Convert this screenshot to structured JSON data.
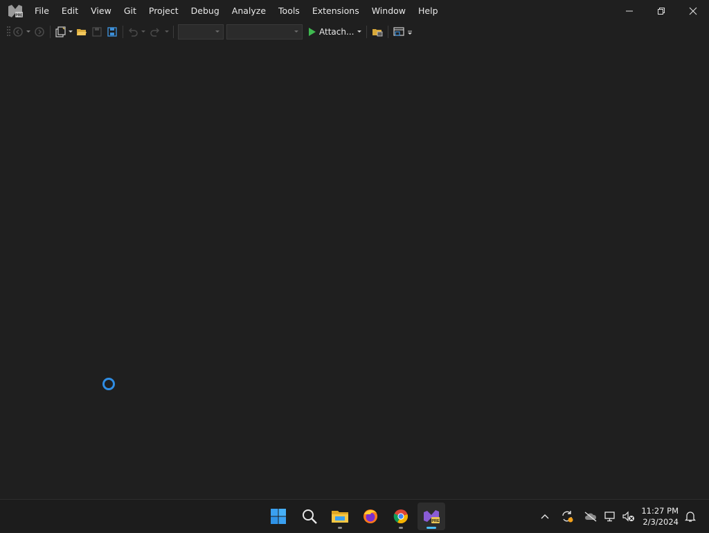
{
  "titlebar": {
    "app_icon": "visual-studio-preview-icon",
    "menu": [
      "File",
      "Edit",
      "View",
      "Git",
      "Project",
      "Debug",
      "Analyze",
      "Tools",
      "Extensions",
      "Window",
      "Help"
    ],
    "controls": [
      "minimize-icon",
      "restore-icon",
      "close-icon"
    ]
  },
  "toolbar": {
    "attach_label": "Attach...",
    "combo_config_value": "",
    "combo_platform_value": ""
  },
  "main": {
    "loading_indicator": "spinner-icon"
  },
  "taskbar": {
    "apps": [
      "windows-start-icon",
      "search-icon",
      "file-explorer-icon",
      "firefox-icon",
      "chrome-icon",
      "visual-studio-preview-icon"
    ],
    "clock_time": "11:27 PM",
    "clock_date": "2/3/2024"
  },
  "colors": {
    "background": "#1f1f1f",
    "accent": "#4cc2ff",
    "vs_purple": "#8a5cd6",
    "play_green": "#3fb950"
  }
}
